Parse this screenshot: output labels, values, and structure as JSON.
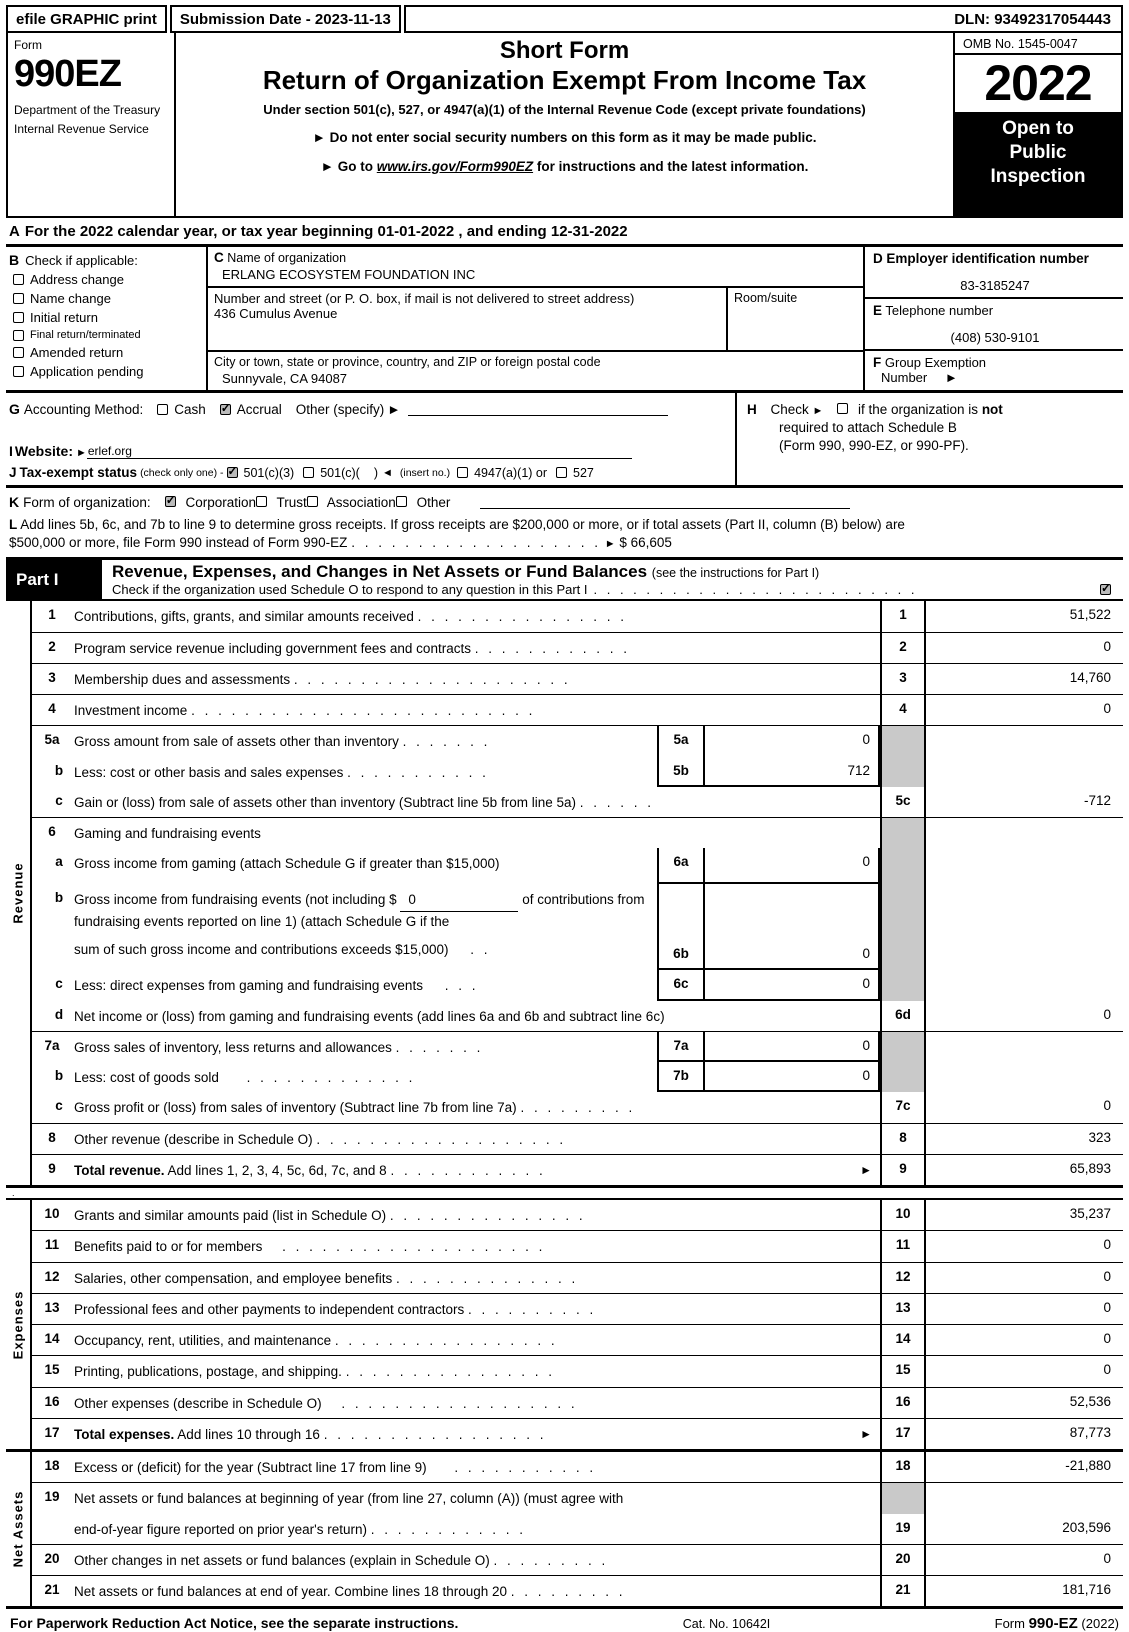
{
  "efile": {
    "graphic_print": "efile GRAPHIC print",
    "submission_date": "Submission Date - 2023-11-13",
    "dln": "DLN: 93492317054443"
  },
  "masthead": {
    "form_label": "Form",
    "form_number": "990EZ",
    "department": "Department of the Treasury",
    "department2": "Internal Revenue Service",
    "title_short": "Short Form",
    "title_main": "Return of Organization Exempt From Income Tax",
    "subtitle": "Under section 501(c), 527, or 4947(a)(1) of the Internal Revenue Code (except private foundations)",
    "bullet1": "Do not enter social security numbers on this form as it may be made public.",
    "bullet2_pre": "Go to",
    "bullet2_link": "www.irs.gov/Form990EZ",
    "bullet2_post": "for instructions and the latest information.",
    "omb": "OMB No. 1545-0047",
    "year": "2022",
    "open_to": "Open to",
    "public": "Public",
    "inspection": "Inspection"
  },
  "line_a": {
    "letter": "A",
    "text": "For the 2022 calendar year, or tax year beginning 01-01-2022 , and ending 12-31-2022"
  },
  "section_b": {
    "letter": "B",
    "heading": "Check if applicable:",
    "items": [
      {
        "label": "Address change",
        "checked": false,
        "small": false
      },
      {
        "label": "Name change",
        "checked": false,
        "small": false
      },
      {
        "label": "Initial return",
        "checked": false,
        "small": false
      },
      {
        "label": "Final return/terminated",
        "checked": false,
        "small": true
      },
      {
        "label": "Amended return",
        "checked": false,
        "small": false
      },
      {
        "label": "Application pending",
        "checked": false,
        "small": false
      }
    ]
  },
  "section_c": {
    "letter": "C",
    "name_caption": "Name of organization",
    "name_value": "ERLANG ECOSYSTEM FOUNDATION INC",
    "street_caption": "Number and street (or P. O. box, if mail is not delivered to street address)",
    "street_value": "436 Cumulus Avenue",
    "room_caption": "Room/suite",
    "room_value": "",
    "city_caption": "City or town, state or province, country, and ZIP or foreign postal code",
    "city_value": "Sunnyvale, CA  94087"
  },
  "section_d": {
    "letter": "D",
    "ein_caption": "Employer identification number",
    "ein_value": "83-3185247",
    "letter_e": "E",
    "phone_caption": "Telephone number",
    "phone_value": "(408) 530-9101",
    "letter_f": "F",
    "group_caption": "Group Exemption",
    "group_caption2": "Number",
    "group_value": ""
  },
  "section_g": {
    "letter": "G",
    "label": "Accounting Method:",
    "cash": "Cash",
    "cash_checked": false,
    "accrual": "Accrual",
    "accrual_checked": true,
    "other": "Other (specify)",
    "other_value": ""
  },
  "section_h": {
    "letter": "H",
    "line1a": "Check",
    "line1b": "if the organization is",
    "line1c": "not",
    "line2": "required to attach Schedule B",
    "line3": "(Form 990, 990-EZ, or 990-PF).",
    "checked": false
  },
  "section_i": {
    "letter": "I",
    "label": "Website:",
    "value": "erlef.org"
  },
  "section_j": {
    "letter": "J",
    "label": "Tax-exempt status",
    "note": "(check only one) -",
    "opt1": "501(c)(3)",
    "opt1_checked": true,
    "opt2": "501(c)(",
    "opt2_checked": false,
    "opt2_tail": ")",
    "insert_no": "(insert no.)",
    "opt3": "4947(a)(1) or",
    "opt3_checked": false,
    "opt4": "527",
    "opt4_checked": false
  },
  "section_k": {
    "letter": "K",
    "label": "Form of organization:",
    "options": [
      {
        "label": "Corporation",
        "checked": true
      },
      {
        "label": "Trust",
        "checked": false
      },
      {
        "label": "Association",
        "checked": false
      },
      {
        "label": "Other",
        "checked": false
      }
    ]
  },
  "section_l": {
    "letter": "L",
    "text1": "Add lines 5b, 6c, and 7b to line 9 to determine gross receipts. If gross receipts are $200,000 or more, or if total assets (Part II, column (B) below) are",
    "text2": "$500,000 or more, file Form 990 instead of Form 990-EZ",
    "amount": "$ 66,605"
  },
  "part1": {
    "tab": "Part I",
    "title": "Revenue, Expenses, and Changes in Net Assets or Fund Balances",
    "title_note": "(see the instructions for Part I)",
    "sched_o": "Check if the organization used Schedule O to respond to any question in this Part I",
    "sched_o_checked": true
  },
  "revenue": {
    "section_label": "Revenue",
    "rows": [
      {
        "num": "1",
        "text": "Contributions, gifts, grants, and similar amounts received",
        "dots": ". . . . . . . . . . . . . . . .",
        "code": "1",
        "amount": "51,522"
      },
      {
        "num": "2",
        "text": "Program service revenue including government fees and contracts",
        "dots": ". . . . . . . . . . . .",
        "code": "2",
        "amount": "0"
      },
      {
        "num": "3",
        "text": "Membership dues and assessments",
        "dots": ". . . . . . . . . . . . . . . . . . . . .",
        "code": "3",
        "amount": "14,760"
      },
      {
        "num": "4",
        "text": "Investment income",
        "dots": ". . . . . . . . . . . . . . . . . . . . . . . . . .",
        "code": "4",
        "amount": "0"
      }
    ],
    "row5a": {
      "num": "5a",
      "text": "Gross amount from sale of assets other than inventory",
      "dots": ". . . . . . .",
      "sub_code": "5a",
      "sub_amount": "0"
    },
    "row5b": {
      "num": "b",
      "text": "Less: cost or other basis and sales expenses",
      "dots": ". . . . . . . . . . .",
      "sub_code": "5b",
      "sub_amount": "712"
    },
    "row5c": {
      "num": "c",
      "text": "Gain or (loss) from sale of assets other than inventory (Subtract line 5b from line 5a)",
      "dots": ". . . . . .",
      "code": "5c",
      "amount": "-712"
    },
    "row6": {
      "num": "6",
      "text": "Gaming and fundraising events"
    },
    "row6a": {
      "num": "a",
      "text": "Gross income from gaming (attach Schedule G if greater than $15,000)",
      "sub_code": "6a",
      "sub_amount": "0"
    },
    "row6b": {
      "num": "b",
      "line1_pre": "Gross income from fundraising events (not including $",
      "line1_val": "0",
      "line1_post": "of contributions from",
      "line2": "fundraising events reported on line 1) (attach Schedule G if the",
      "line3": "sum of such gross income and contributions exceeds $15,000)",
      "dots": ". .",
      "sub_code": "6b",
      "sub_amount": "0"
    },
    "row6c": {
      "num": "c",
      "text": "Less: direct expenses from gaming and fundraising events",
      "dots": ". . .",
      "sub_code": "6c",
      "sub_amount": "0"
    },
    "row6d": {
      "num": "d",
      "text": "Net income or (loss) from gaming and fundraising events (add lines 6a and 6b and subtract line 6c)",
      "code": "6d",
      "amount": "0"
    },
    "row7a": {
      "num": "7a",
      "text": "Gross sales of inventory, less returns and allowances",
      "dots": ". . . . . . .",
      "sub_code": "7a",
      "sub_amount": "0"
    },
    "row7b": {
      "num": "b",
      "text": "Less: cost of goods sold",
      "dots": ". . . . . . . . . . . . .",
      "sub_code": "7b",
      "sub_amount": "0"
    },
    "row7c": {
      "num": "c",
      "text": "Gross profit or (loss) from sales of inventory (Subtract line 7b from line 7a)",
      "dots": ". . . . . . . . .",
      "code": "7c",
      "amount": "0"
    },
    "row8": {
      "num": "8",
      "text": "Other revenue (describe in Schedule O)",
      "dots": ". . . . . . . . . . . . . . . . . . .",
      "code": "8",
      "amount": "323"
    },
    "row9": {
      "num": "9",
      "text_bold": "Total revenue.",
      "text": " Add lines 1, 2, 3, 4, 5c, 6d, 7c, and 8",
      "dots": ". . . . . . . . . . . .",
      "code": "9",
      "amount": "65,893"
    }
  },
  "expenses": {
    "section_label": "Expenses",
    "rows": [
      {
        "num": "10",
        "text": "Grants and similar amounts paid (list in Schedule O)",
        "dots": ". . . . . . . . . . . . . . .",
        "code": "10",
        "amount": "35,237"
      },
      {
        "num": "11",
        "text": "Benefits paid to or for members",
        "dots": ". . . . . . . . . . . . . . . . . . . .",
        "code": "11",
        "amount": "0"
      },
      {
        "num": "12",
        "text": "Salaries, other compensation, and employee benefits",
        "dots": ". . . . . . . . . . . . . .",
        "code": "12",
        "amount": "0"
      },
      {
        "num": "13",
        "text": "Professional fees and other payments to independent contractors",
        "dots": ". . . . . . . . . .",
        "code": "13",
        "amount": "0"
      },
      {
        "num": "14",
        "text": "Occupancy, rent, utilities, and maintenance",
        "dots": ". . . . . . . . . . . . . . . . .",
        "code": "14",
        "amount": "0"
      },
      {
        "num": "15",
        "text": "Printing, publications, postage, and shipping.",
        "dots": ". . . . . . . . . . . . . . . .",
        "code": "15",
        "amount": "0"
      },
      {
        "num": "16",
        "text": "Other expenses (describe in Schedule O)",
        "dots": ". . . . . . . . . . . . . . . . . .",
        "code": "16",
        "amount": "52,536"
      }
    ],
    "row17": {
      "num": "17",
      "text_bold": "Total expenses.",
      "text": " Add lines 10 through 16",
      "dots": ". . . . . . . . . . . . . . . . .",
      "code": "17",
      "amount": "87,773"
    }
  },
  "net_assets": {
    "section_label": "Net Assets",
    "row18": {
      "num": "18",
      "text": "Excess or (deficit) for the year (Subtract line 17 from line 9)",
      "dots": ". . . . . . . . . . .",
      "code": "18",
      "amount": "-21,880"
    },
    "row19": {
      "num": "19",
      "line1": "Net assets or fund balances at beginning of year (from line 27, column (A)) (must agree with",
      "line2": "end-of-year figure reported on prior year's return)",
      "dots": ". . . . . . . . . . . .",
      "code": "19",
      "amount": "203,596"
    },
    "row20": {
      "num": "20",
      "text": "Other changes in net assets or fund balances (explain in Schedule O)",
      "dots": ". . . . . . . . .",
      "code": "20",
      "amount": "0"
    },
    "row21": {
      "num": "21",
      "text": "Net assets or fund balances at end of year. Combine lines 18 through 20",
      "dots": ". . . . . . . . .",
      "code": "21",
      "amount": "181,716"
    }
  },
  "footer": {
    "paperwork": "For Paperwork Reduction Act Notice, see the separate instructions.",
    "cat": "Cat. No. 10642I",
    "form_pre": "Form",
    "form_no": "990-EZ",
    "form_year": "(2022)"
  }
}
